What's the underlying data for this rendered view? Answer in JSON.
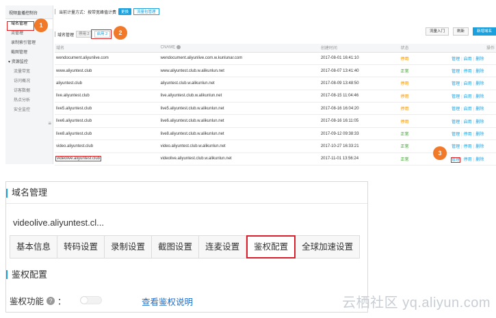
{
  "sidebar": {
    "title": "视频直播控制台",
    "items": [
      {
        "label": "域名管理",
        "active": true
      },
      {
        "label": "流管理"
      },
      {
        "label": "录制索引管理"
      },
      {
        "label": "截图管理"
      },
      {
        "label": "资源监控"
      },
      {
        "label": "流量带宽"
      },
      {
        "label": "访问概况"
      },
      {
        "label": "访客数据"
      },
      {
        "label": "热点分析"
      },
      {
        "label": "安全监控"
      }
    ]
  },
  "billing": {
    "text": "当前计量方式：按带宽峰值计费",
    "change_label": "更换",
    "package_label": "流量包管理"
  },
  "filter": {
    "label": "域名管理",
    "chip_disabled": "停用 2",
    "chip_enabled": "启用 2"
  },
  "actions": {
    "guide": "流量入门",
    "refresh": "刷新",
    "add": "新增域名"
  },
  "table": {
    "headers": [
      "域名",
      "CNAME",
      "创建时间",
      "状态",
      "",
      "操作"
    ],
    "rows": [
      {
        "domain": "wendocument.aliyunlive.com",
        "cname": "wendocument.aliyunlive.com.w.kunlunar.com",
        "created": "2017-08-01 16:41:10",
        "status": "停用",
        "ok": false
      },
      {
        "domain": "www.aliyuntest.club",
        "cname": "www.aliyuntest.club.w.alikunlun.net",
        "created": "2017-08-07 13:41:40",
        "status": "正常",
        "ok": true
      },
      {
        "domain": "aliyuntest.club",
        "cname": "aliyuntest.club.w.alikunlun.net",
        "created": "2017-08-09 13:48:50",
        "status": "停用",
        "ok": false
      },
      {
        "domain": "live.aliyuntest.club",
        "cname": "live.aliyuntest.club.w.alikunlun.net",
        "created": "2017-08-15 11:04:46",
        "status": "停用",
        "ok": false
      },
      {
        "domain": "live5.aliyuntest.club",
        "cname": "live5.aliyuntest.club.w.alikunlun.net",
        "created": "2017-08-16 16:04:20",
        "status": "停用",
        "ok": false
      },
      {
        "domain": "live6.aliyuntest.club",
        "cname": "live6.aliyuntest.club.w.alikunlun.net",
        "created": "2017-08-16 16:11:05",
        "status": "停用",
        "ok": false
      },
      {
        "domain": "live8.aliyuntest.club",
        "cname": "live8.aliyuntest.club.w.alikunlun.net",
        "created": "2017-09-12 09:38:33",
        "status": "正常",
        "ok": true
      },
      {
        "domain": "video.aliyuntest.club",
        "cname": "video.aliyuntest.club.w.alikunlun.net",
        "created": "2017-10-27 16:33:21",
        "status": "正常",
        "ok": true
      },
      {
        "domain": "videolive.aliyuntest.club",
        "cname": "videolive.aliyuntest.club.w.alikunlun.net",
        "created": "2017-11-01 13:56:24",
        "status": "正常",
        "ok": true
      }
    ],
    "op_manage": "管理",
    "op_toggle_on": "启用",
    "op_toggle_off": "停用",
    "op_delete": "删除"
  },
  "steps": [
    "1",
    "2",
    "3"
  ],
  "detail": {
    "title": "域名管理",
    "domain": "videolive.aliyuntest.cl...",
    "tabs": [
      "基本信息",
      "转码设置",
      "录制设置",
      "截图设置",
      "连麦设置",
      "鉴权配置",
      "全球加速设置"
    ],
    "active_tab": 5,
    "section": "鉴权配置",
    "field_label": "鉴权功能",
    "field_colon": "：",
    "help_link": "查看鉴权说明"
  },
  "watermark": "云栖社区 yq.aliyun.com",
  "colors": {
    "accent": "#1aa0dc",
    "highlight": "#e02020",
    "step_badge": "#f1792a",
    "status_ok": "#3c9a2e",
    "status_off": "#f39200"
  }
}
